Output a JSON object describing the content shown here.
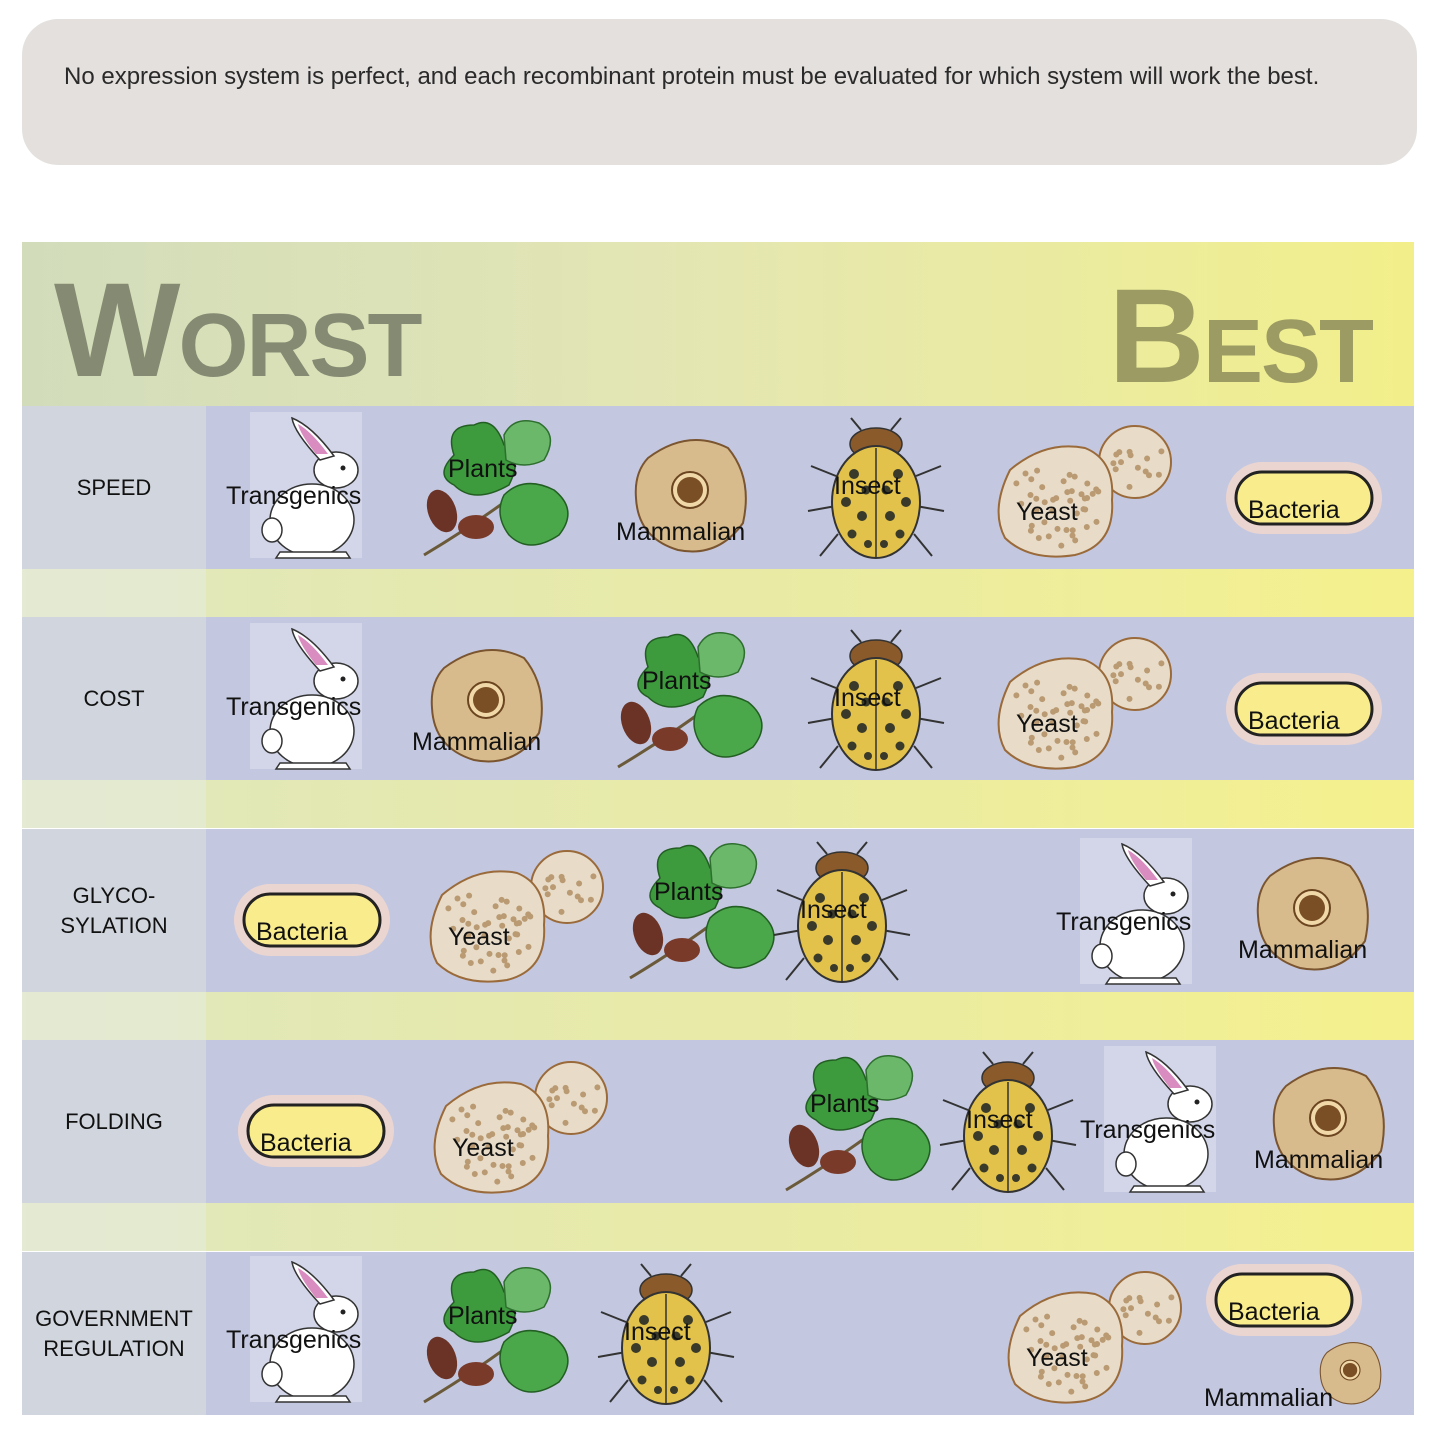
{
  "note": "No expression system is perfect, and each recombinant protein must be evaluated for which system will work the best.",
  "header": {
    "worst_initial": "W",
    "worst_rest": "ORST",
    "best_initial": "B",
    "best_rest": "EST"
  },
  "rows": [
    {
      "label": "SPEED",
      "order": [
        "Transgenics",
        "Plants",
        "Mammalian",
        "Insect",
        "Yeast",
        "Bacteria"
      ]
    },
    {
      "label": "COST",
      "order": [
        "Transgenics",
        "Mammalian",
        "Plants",
        "Insect",
        "Yeast",
        "Bacteria"
      ]
    },
    {
      "label": "GLYCO-\nSYLATION",
      "order": [
        "Bacteria",
        "Yeast",
        "Plants",
        "Insect",
        "Transgenics",
        "Mammalian"
      ]
    },
    {
      "label": "FOLDING",
      "order": [
        "Bacteria",
        "Yeast",
        "Plants",
        "Insect",
        "Transgenics",
        "Mammalian"
      ]
    },
    {
      "label": "GOVERNMENT\nREGULATION",
      "order": [
        "Transgenics",
        "Plants",
        "Insect",
        "Yeast",
        "Bacteria",
        "Mammalian"
      ]
    }
  ],
  "colors": {
    "header_worst": "#858b73",
    "header_best": "#9c9b63",
    "row_bg": "#c3c8e0",
    "label_bg": "#d1d6de"
  }
}
